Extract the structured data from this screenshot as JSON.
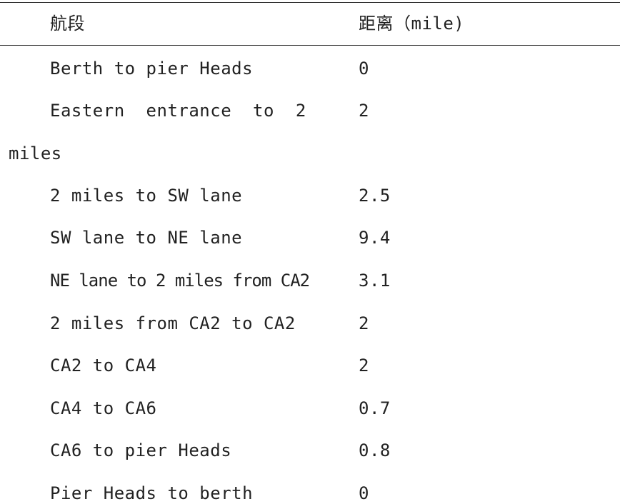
{
  "table": {
    "headers": [
      "航段",
      "距离（mile)"
    ],
    "rows": [
      {
        "segment": "Berth to pier Heads",
        "distance": "0"
      },
      {
        "segment": "Eastern  entrance  to  2",
        "segment_wrap": "miles",
        "distance": "2"
      },
      {
        "segment": "2 miles to SW lane",
        "distance": "2.5"
      },
      {
        "segment": "SW lane to NE lane",
        "distance": "9.4"
      },
      {
        "segment": "NE lane to 2 miles from CA2",
        "distance": "3.1"
      },
      {
        "segment": "2 miles from CA2 to CA2",
        "distance": "2"
      },
      {
        "segment": "CA2 to CA4",
        "distance": "2"
      },
      {
        "segment": "CA4 to CA6",
        "distance": "0.7"
      },
      {
        "segment": "CA6 to pier Heads",
        "distance": "0.8"
      },
      {
        "segment": "Pier Heads to berth",
        "distance": "0"
      }
    ]
  }
}
